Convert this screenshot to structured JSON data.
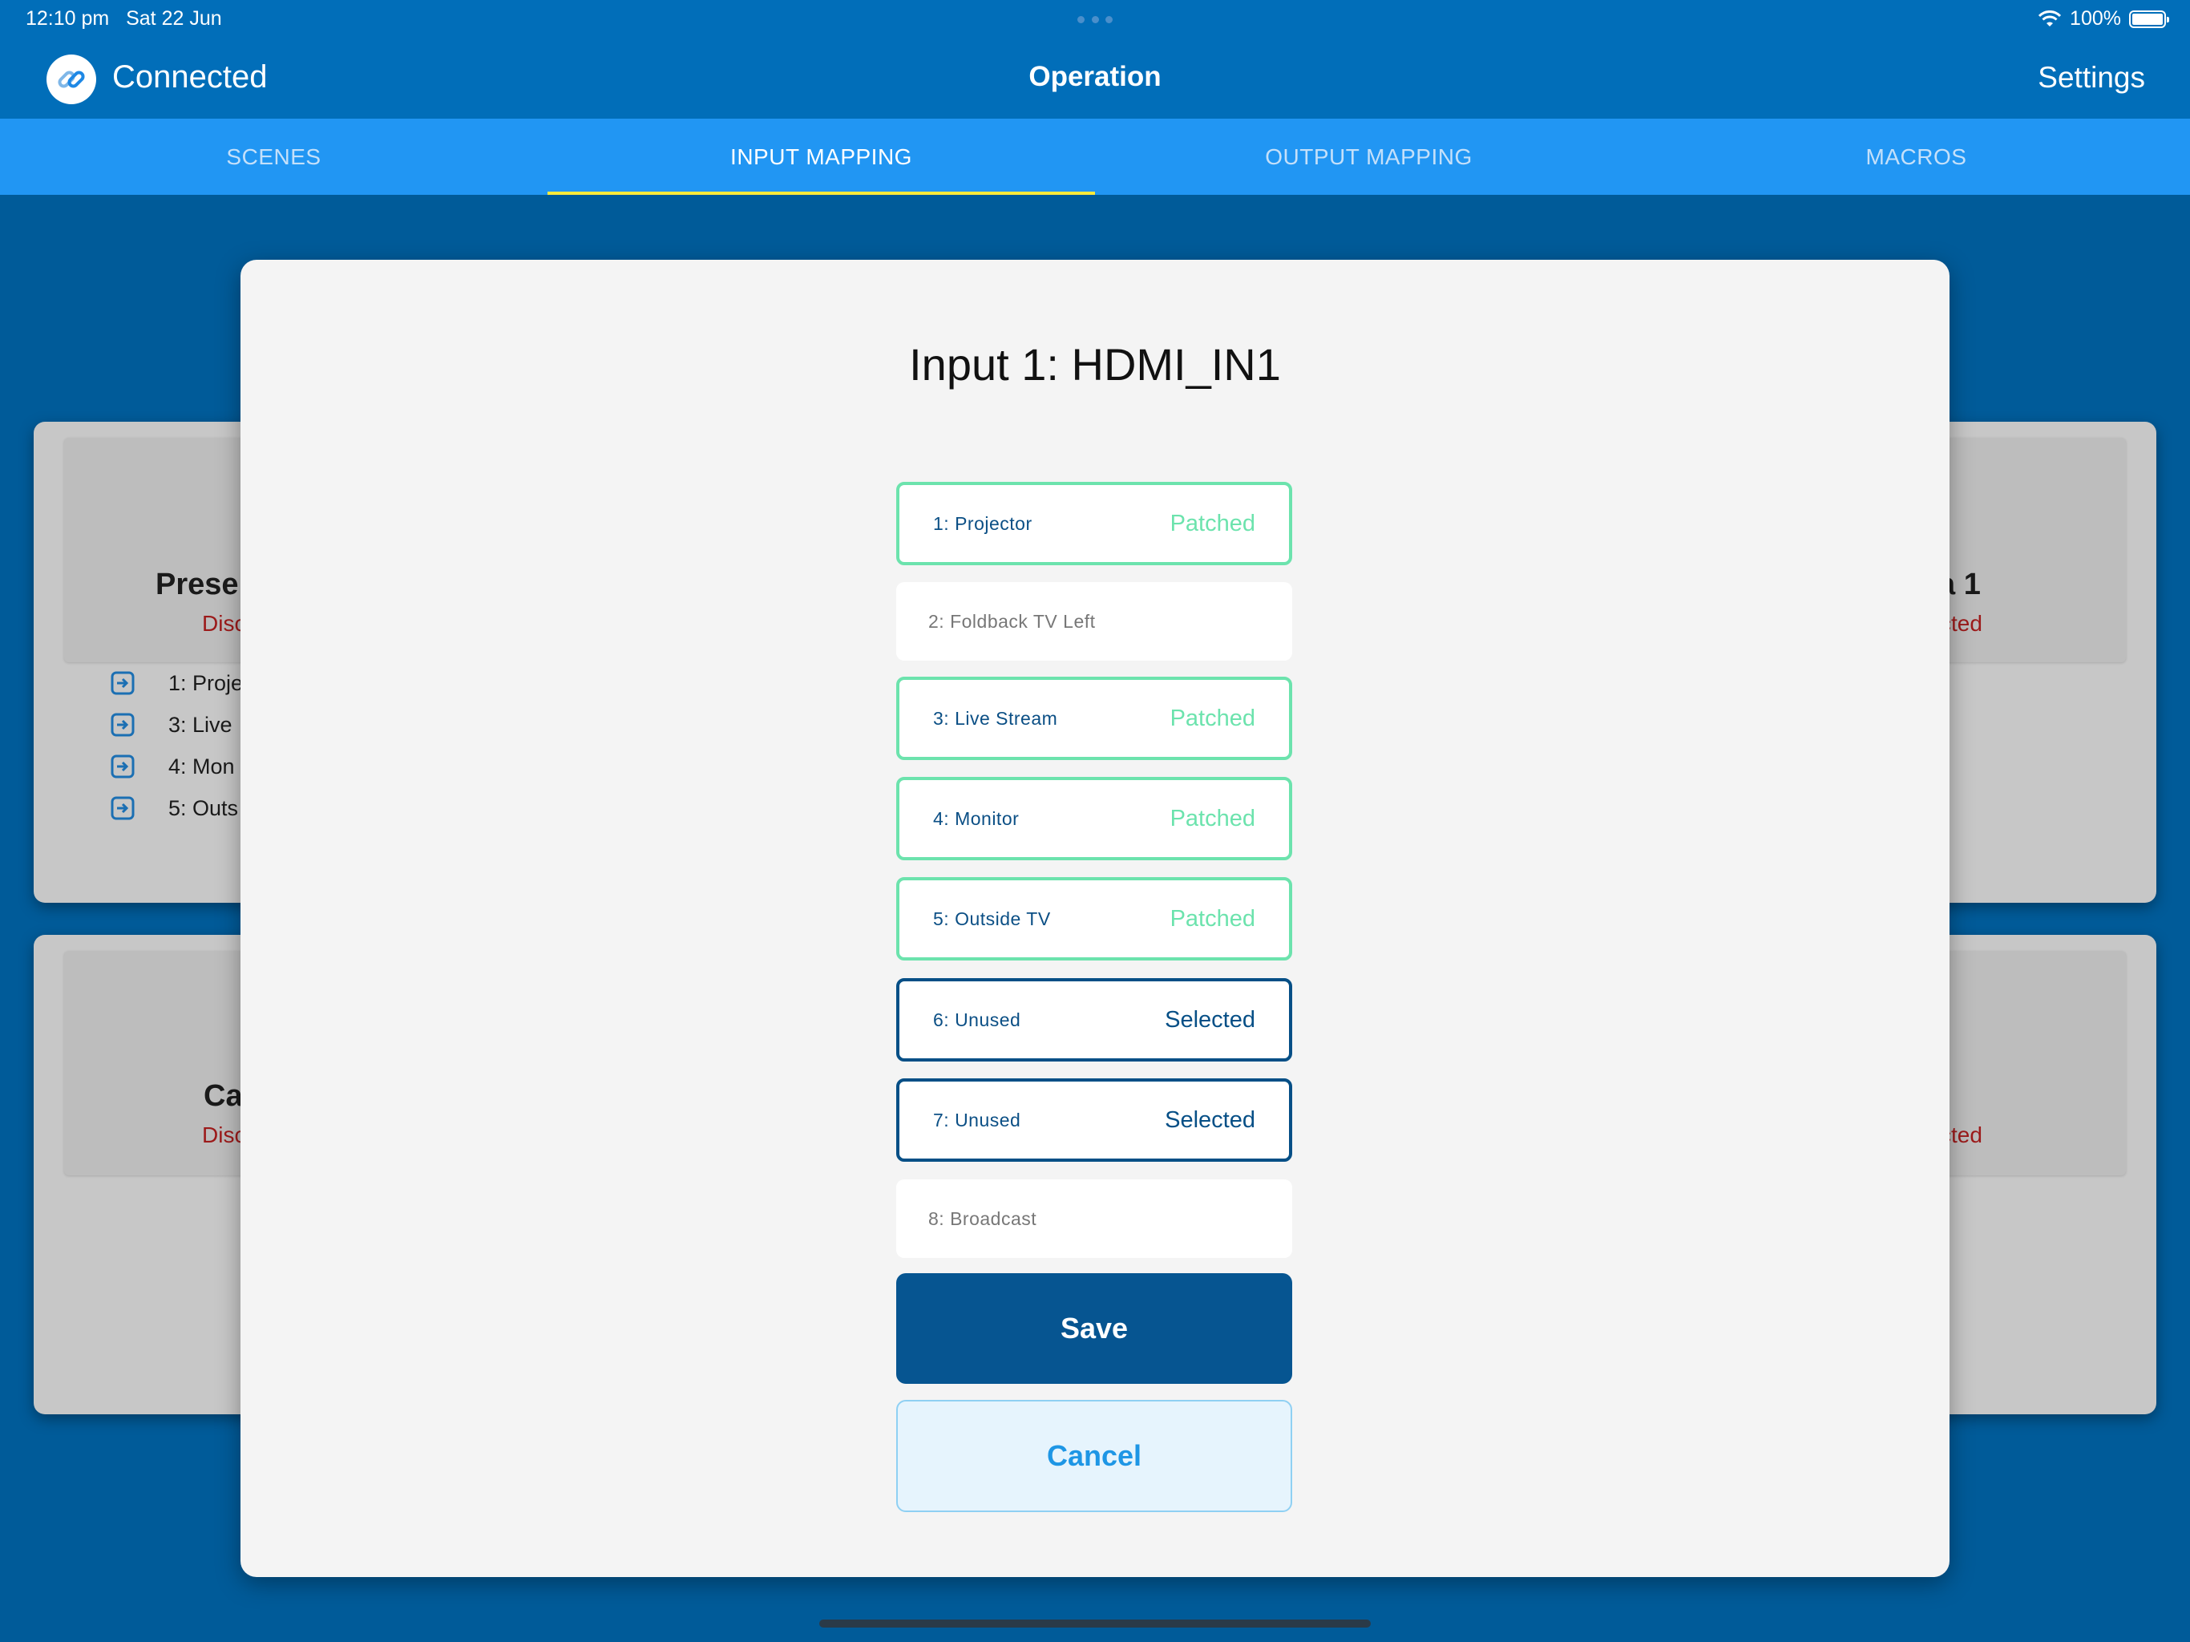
{
  "status_bar": {
    "time": "12:10 pm",
    "date": "Sat 22 Jun",
    "battery": "100%"
  },
  "nav": {
    "connection": "Connected",
    "title": "Operation",
    "settings": "Settings"
  },
  "tabs": [
    {
      "label": "SCENES"
    },
    {
      "label": "INPUT MAPPING",
      "active": true
    },
    {
      "label": "OUTPUT MAPPING"
    },
    {
      "label": "MACROS"
    }
  ],
  "background": {
    "card1": {
      "title": "Prese",
      "status": "Disc",
      "rows": [
        {
          "label": "1: Proje"
        },
        {
          "label": "3: Live"
        },
        {
          "label": "4: Mon"
        },
        {
          "label": "5: Outs"
        }
      ]
    },
    "card2": {
      "title": "a 1",
      "status": "cted"
    },
    "card3": {
      "title": "Ca",
      "status": "Disc"
    },
    "card4": {
      "status": "cted"
    }
  },
  "modal": {
    "title": "Input 1: HDMI_IN1",
    "options": [
      {
        "label": "1: Projector",
        "state": "Patched"
      },
      {
        "label": "2: Foldback TV Left",
        "state": ""
      },
      {
        "label": "3: Live Stream",
        "state": "Patched"
      },
      {
        "label": "4: Monitor",
        "state": "Patched"
      },
      {
        "label": "5: Outside TV",
        "state": "Patched"
      },
      {
        "label": "6: Unused",
        "state": "Selected"
      },
      {
        "label": "7: Unused",
        "state": "Selected"
      },
      {
        "label": "8: Broadcast",
        "state": ""
      }
    ],
    "save_label": "Save",
    "cancel_label": "Cancel"
  },
  "colors": {
    "nav_bar": "#016eb9",
    "tab_bar": "#2196f3",
    "tab_indicator": "#ffeb3b",
    "patched": "#6ce3ad",
    "selected": "#064f86",
    "save": "#065591",
    "cancel_text": "#1e96e5",
    "disconnected": "#9c1a1a"
  }
}
